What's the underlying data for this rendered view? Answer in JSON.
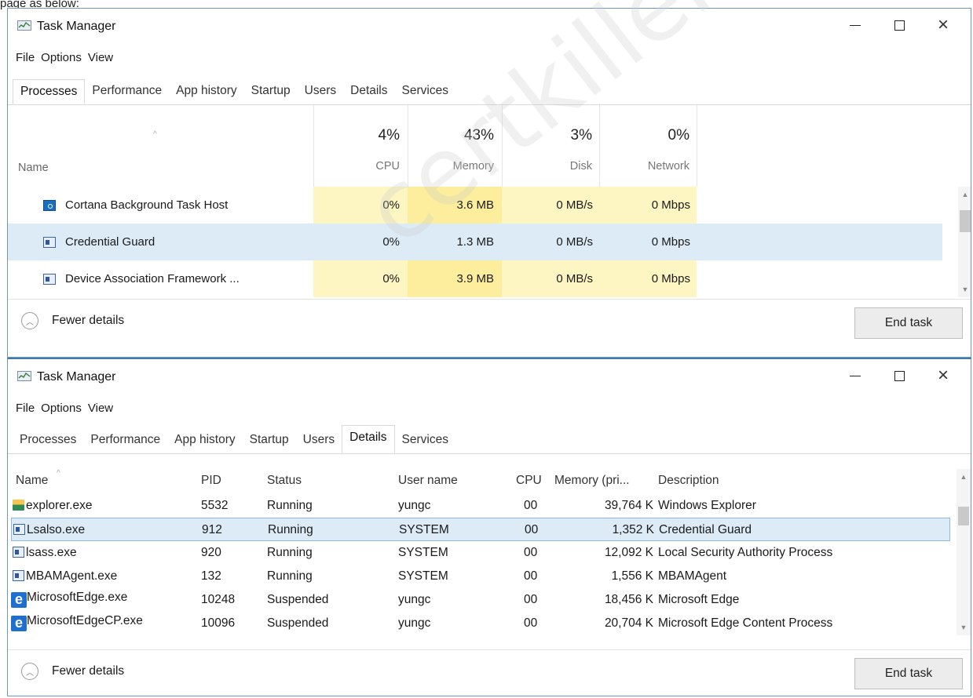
{
  "caption": "page as below:",
  "watermark": "certkillers.net",
  "top_window": {
    "title": "Task Manager",
    "menu": [
      "File",
      "Options",
      "View"
    ],
    "tabs": [
      "Processes",
      "Performance",
      "App history",
      "Startup",
      "Users",
      "Details",
      "Services"
    ],
    "active_tab": "Processes",
    "header": {
      "name": "Name",
      "cpu_pct": "4%",
      "cpu": "CPU",
      "mem_pct": "43%",
      "mem": "Memory",
      "disk_pct": "3%",
      "disk": "Disk",
      "net_pct": "0%",
      "net": "Network"
    },
    "rows": [
      {
        "name": "Cortana Background Task Host",
        "cpu": "0%",
        "memory": "3.6 MB",
        "disk": "0 MB/s",
        "network": "0 Mbps",
        "icon": "cortana-icon"
      },
      {
        "name": "Credential Guard",
        "cpu": "0%",
        "memory": "1.3 MB",
        "disk": "0 MB/s",
        "network": "0 Mbps",
        "icon": "app-icon",
        "selected": true
      },
      {
        "name": "Device Association Framework ...",
        "cpu": "0%",
        "memory": "3.9 MB",
        "disk": "0 MB/s",
        "network": "0 Mbps",
        "icon": "app-icon"
      }
    ],
    "fewer_details": "Fewer details",
    "end_task": "End task"
  },
  "bottom_window": {
    "title": "Task Manager",
    "menu": [
      "File",
      "Options",
      "View"
    ],
    "tabs": [
      "Processes",
      "Performance",
      "App history",
      "Startup",
      "Users",
      "Details",
      "Services"
    ],
    "active_tab": "Details",
    "columns": [
      "Name",
      "PID",
      "Status",
      "User name",
      "CPU",
      "Memory (pri...",
      "Description"
    ],
    "rows": [
      {
        "name": "explorer.exe",
        "pid": "5532",
        "status": "Running",
        "user": "yungc",
        "cpu": "00",
        "memory": "39,764 K",
        "description": "Windows Explorer",
        "icon": "explorer-icon"
      },
      {
        "name": "Lsalso.exe",
        "pid": "912",
        "status": "Running",
        "user": "SYSTEM",
        "cpu": "00",
        "memory": "1,352 K",
        "description": "Credential Guard",
        "icon": "app-icon",
        "selected": true
      },
      {
        "name": "lsass.exe",
        "pid": "920",
        "status": "Running",
        "user": "SYSTEM",
        "cpu": "00",
        "memory": "12,092 K",
        "description": "Local Security Authority Process",
        "icon": "app-icon"
      },
      {
        "name": "MBAMAgent.exe",
        "pid": "132",
        "status": "Running",
        "user": "SYSTEM",
        "cpu": "00",
        "memory": "1,556 K",
        "description": "MBAMAgent",
        "icon": "app-icon"
      },
      {
        "name": "MicrosoftEdge.exe",
        "pid": "10248",
        "status": "Suspended",
        "user": "yungc",
        "cpu": "00",
        "memory": "18,456 K",
        "description": "Microsoft Edge",
        "icon": "edge-icon"
      },
      {
        "name": "MicrosoftEdgeCP.exe",
        "pid": "10096",
        "status": "Suspended",
        "user": "yungc",
        "cpu": "00",
        "memory": "20,704 K",
        "description": "Microsoft Edge Content Process",
        "icon": "edge-icon"
      }
    ],
    "fewer_details": "Fewer details",
    "end_task": "End task"
  }
}
